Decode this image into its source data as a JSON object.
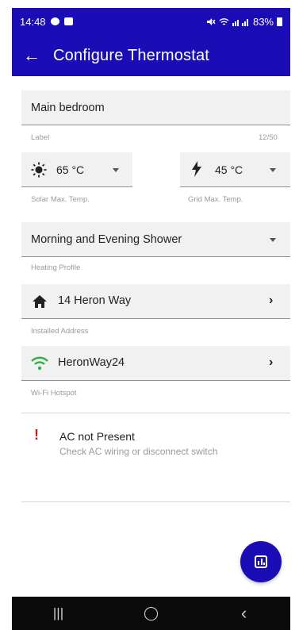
{
  "status": {
    "time": "14:48",
    "battery": "83%"
  },
  "header": {
    "back_glyph": "←",
    "title": "Configure Thermostat"
  },
  "label_field": {
    "value": "Main bedroom",
    "helper": "Label",
    "counter": "12/50"
  },
  "solar": {
    "value": "65 °C",
    "helper": "Solar Max. Temp.",
    "icon": "sun-icon"
  },
  "grid": {
    "value": "45 °C",
    "helper": "Grid Max. Temp.",
    "icon": "bolt-icon"
  },
  "heating": {
    "value": "Morning and Evening Shower",
    "helper": "Heating Profile"
  },
  "address": {
    "value": "14 Heron Way",
    "helper": "Installed Address",
    "icon": "home-icon"
  },
  "wifi": {
    "value": "HeronWay24",
    "helper": "Wi-Fi Hotspot",
    "icon": "wifi-icon",
    "icon_color": "#2fae4a"
  },
  "alert": {
    "title": "AC not Present",
    "subtitle": "Check AC wiring or disconnect switch",
    "icon_color": "#d11a1a"
  },
  "fab": {
    "icon": "chart-icon"
  },
  "nav": {
    "recents": "|||",
    "home": "◯",
    "back": "‹"
  },
  "colors": {
    "primary": "#1a0db5",
    "field_bg": "#f1f1f1"
  }
}
